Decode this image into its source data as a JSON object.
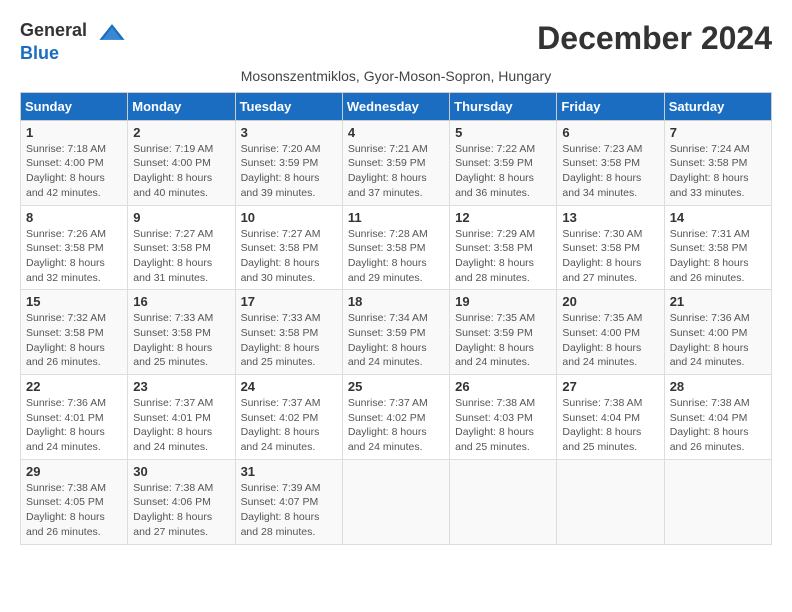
{
  "logo": {
    "general": "General",
    "blue": "Blue"
  },
  "title": "December 2024",
  "subtitle": "Mosonszentmiklos, Gyor-Moson-Sopron, Hungary",
  "headers": [
    "Sunday",
    "Monday",
    "Tuesday",
    "Wednesday",
    "Thursday",
    "Friday",
    "Saturday"
  ],
  "weeks": [
    [
      {
        "day": "1",
        "sunrise": "7:18 AM",
        "sunset": "4:00 PM",
        "daylight": "8 hours and 42 minutes."
      },
      {
        "day": "2",
        "sunrise": "7:19 AM",
        "sunset": "4:00 PM",
        "daylight": "8 hours and 40 minutes."
      },
      {
        "day": "3",
        "sunrise": "7:20 AM",
        "sunset": "3:59 PM",
        "daylight": "8 hours and 39 minutes."
      },
      {
        "day": "4",
        "sunrise": "7:21 AM",
        "sunset": "3:59 PM",
        "daylight": "8 hours and 37 minutes."
      },
      {
        "day": "5",
        "sunrise": "7:22 AM",
        "sunset": "3:59 PM",
        "daylight": "8 hours and 36 minutes."
      },
      {
        "day": "6",
        "sunrise": "7:23 AM",
        "sunset": "3:58 PM",
        "daylight": "8 hours and 34 minutes."
      },
      {
        "day": "7",
        "sunrise": "7:24 AM",
        "sunset": "3:58 PM",
        "daylight": "8 hours and 33 minutes."
      }
    ],
    [
      {
        "day": "8",
        "sunrise": "7:26 AM",
        "sunset": "3:58 PM",
        "daylight": "8 hours and 32 minutes."
      },
      {
        "day": "9",
        "sunrise": "7:27 AM",
        "sunset": "3:58 PM",
        "daylight": "8 hours and 31 minutes."
      },
      {
        "day": "10",
        "sunrise": "7:27 AM",
        "sunset": "3:58 PM",
        "daylight": "8 hours and 30 minutes."
      },
      {
        "day": "11",
        "sunrise": "7:28 AM",
        "sunset": "3:58 PM",
        "daylight": "8 hours and 29 minutes."
      },
      {
        "day": "12",
        "sunrise": "7:29 AM",
        "sunset": "3:58 PM",
        "daylight": "8 hours and 28 minutes."
      },
      {
        "day": "13",
        "sunrise": "7:30 AM",
        "sunset": "3:58 PM",
        "daylight": "8 hours and 27 minutes."
      },
      {
        "day": "14",
        "sunrise": "7:31 AM",
        "sunset": "3:58 PM",
        "daylight": "8 hours and 26 minutes."
      }
    ],
    [
      {
        "day": "15",
        "sunrise": "7:32 AM",
        "sunset": "3:58 PM",
        "daylight": "8 hours and 26 minutes."
      },
      {
        "day": "16",
        "sunrise": "7:33 AM",
        "sunset": "3:58 PM",
        "daylight": "8 hours and 25 minutes."
      },
      {
        "day": "17",
        "sunrise": "7:33 AM",
        "sunset": "3:58 PM",
        "daylight": "8 hours and 25 minutes."
      },
      {
        "day": "18",
        "sunrise": "7:34 AM",
        "sunset": "3:59 PM",
        "daylight": "8 hours and 24 minutes."
      },
      {
        "day": "19",
        "sunrise": "7:35 AM",
        "sunset": "3:59 PM",
        "daylight": "8 hours and 24 minutes."
      },
      {
        "day": "20",
        "sunrise": "7:35 AM",
        "sunset": "4:00 PM",
        "daylight": "8 hours and 24 minutes."
      },
      {
        "day": "21",
        "sunrise": "7:36 AM",
        "sunset": "4:00 PM",
        "daylight": "8 hours and 24 minutes."
      }
    ],
    [
      {
        "day": "22",
        "sunrise": "7:36 AM",
        "sunset": "4:01 PM",
        "daylight": "8 hours and 24 minutes."
      },
      {
        "day": "23",
        "sunrise": "7:37 AM",
        "sunset": "4:01 PM",
        "daylight": "8 hours and 24 minutes."
      },
      {
        "day": "24",
        "sunrise": "7:37 AM",
        "sunset": "4:02 PM",
        "daylight": "8 hours and 24 minutes."
      },
      {
        "day": "25",
        "sunrise": "7:37 AM",
        "sunset": "4:02 PM",
        "daylight": "8 hours and 24 minutes."
      },
      {
        "day": "26",
        "sunrise": "7:38 AM",
        "sunset": "4:03 PM",
        "daylight": "8 hours and 25 minutes."
      },
      {
        "day": "27",
        "sunrise": "7:38 AM",
        "sunset": "4:04 PM",
        "daylight": "8 hours and 25 minutes."
      },
      {
        "day": "28",
        "sunrise": "7:38 AM",
        "sunset": "4:04 PM",
        "daylight": "8 hours and 26 minutes."
      }
    ],
    [
      {
        "day": "29",
        "sunrise": "7:38 AM",
        "sunset": "4:05 PM",
        "daylight": "8 hours and 26 minutes."
      },
      {
        "day": "30",
        "sunrise": "7:38 AM",
        "sunset": "4:06 PM",
        "daylight": "8 hours and 27 minutes."
      },
      {
        "day": "31",
        "sunrise": "7:39 AM",
        "sunset": "4:07 PM",
        "daylight": "8 hours and 28 minutes."
      },
      null,
      null,
      null,
      null
    ]
  ]
}
